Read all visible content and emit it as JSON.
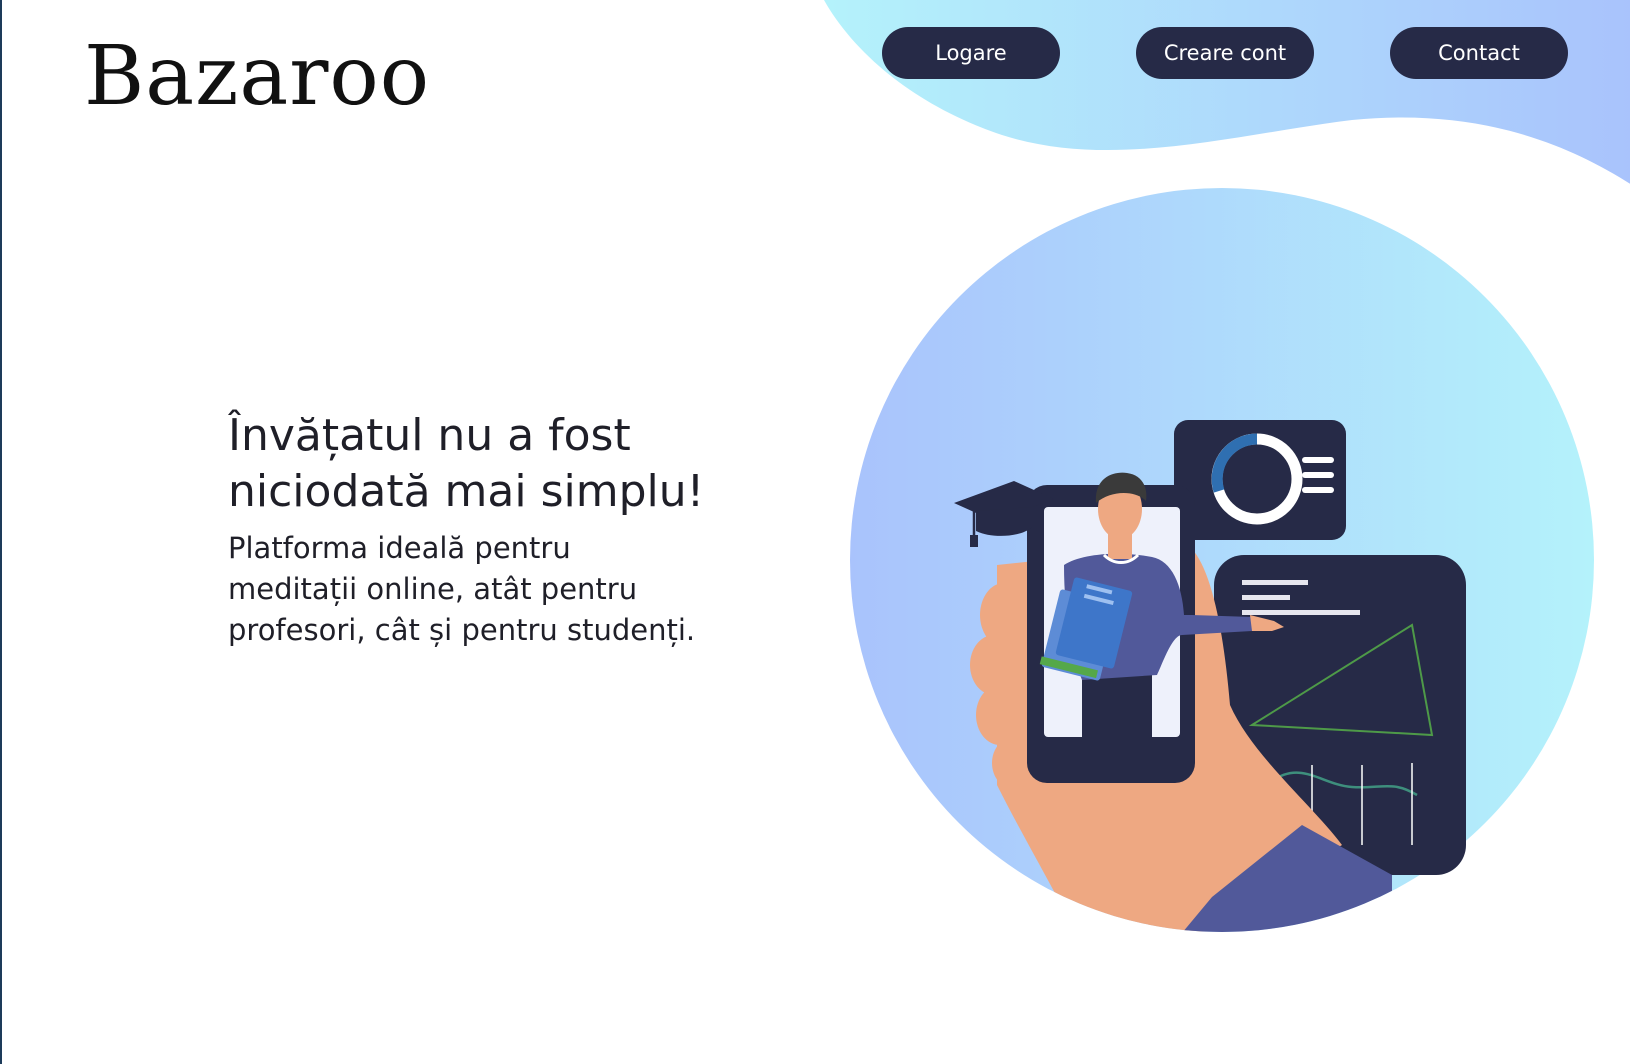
{
  "brand": {
    "logo_text": "Bazaroo"
  },
  "nav": {
    "login_label": "Logare",
    "signup_label": "Creare cont",
    "contact_label": "Contact"
  },
  "hero": {
    "title": "Învățatul nu a fost niciodată mai simplu!",
    "subtitle": "Platforma ideală pentru meditații online, atât pentru profesori, cât și pentru studenți."
  },
  "colors": {
    "nav_button_bg": "#262a47",
    "nav_button_text": "#ffffff",
    "gradient_cyan": "#b4f2fb",
    "gradient_blue": "#a9c3fc",
    "illustration_dark": "#262a47",
    "shirt_purple": "#51599a",
    "skin": "#eea882"
  },
  "icons": {
    "graduation_cap": "graduation-cap-icon",
    "donut_chart": "donut-chart-icon",
    "line_chart": "line-chart-icon",
    "books": "books-icon"
  }
}
